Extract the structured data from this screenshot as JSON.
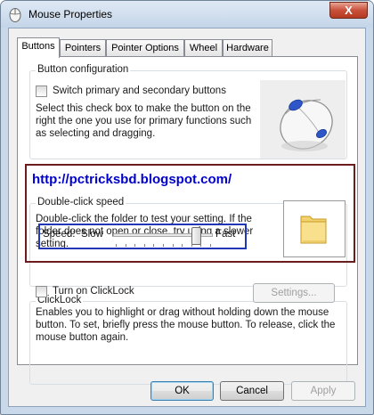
{
  "window": {
    "title": "Mouse Properties",
    "close_label": "X"
  },
  "tabs": [
    {
      "label": "Buttons",
      "active": true
    },
    {
      "label": "Pointers",
      "active": false
    },
    {
      "label": "Pointer Options",
      "active": false
    },
    {
      "label": "Wheel",
      "active": false
    },
    {
      "label": "Hardware",
      "active": false
    }
  ],
  "button_config": {
    "group_label": "Button configuration",
    "switch_checkbox_label": "Switch primary and secondary buttons",
    "switch_checked": false,
    "description": [
      "Select this check box to make the button on the",
      "right the one you use for primary functions such",
      "as selecting and dragging."
    ]
  },
  "watermark": "http://pctricksbd.blogspot.com/",
  "double_click": {
    "group_label": "Double-click speed",
    "description": [
      "Double-click the folder to test your setting. If the",
      "folder does not open or close, try using a slower",
      "setting."
    ],
    "speed_label": "Speed:",
    "slow_label": "Slow",
    "fast_label": "Fast",
    "speed_value": 0.85
  },
  "clicklock": {
    "group_label": "ClickLock",
    "checkbox_label": "Turn on ClickLock",
    "checked": false,
    "settings_label": "Settings...",
    "description": [
      "Enables you to highlight or drag without holding down the mouse",
      "button. To set, briefly press the mouse button. To release, click the",
      "mouse button again."
    ]
  },
  "footer": {
    "ok_label": "OK",
    "cancel_label": "Cancel",
    "apply_label": "Apply"
  },
  "colors": {
    "window_frame": "#c9d9ea",
    "link": "#0000cc",
    "red_highlight": "#6b1c1c",
    "blue_highlight": "#2236b8"
  }
}
